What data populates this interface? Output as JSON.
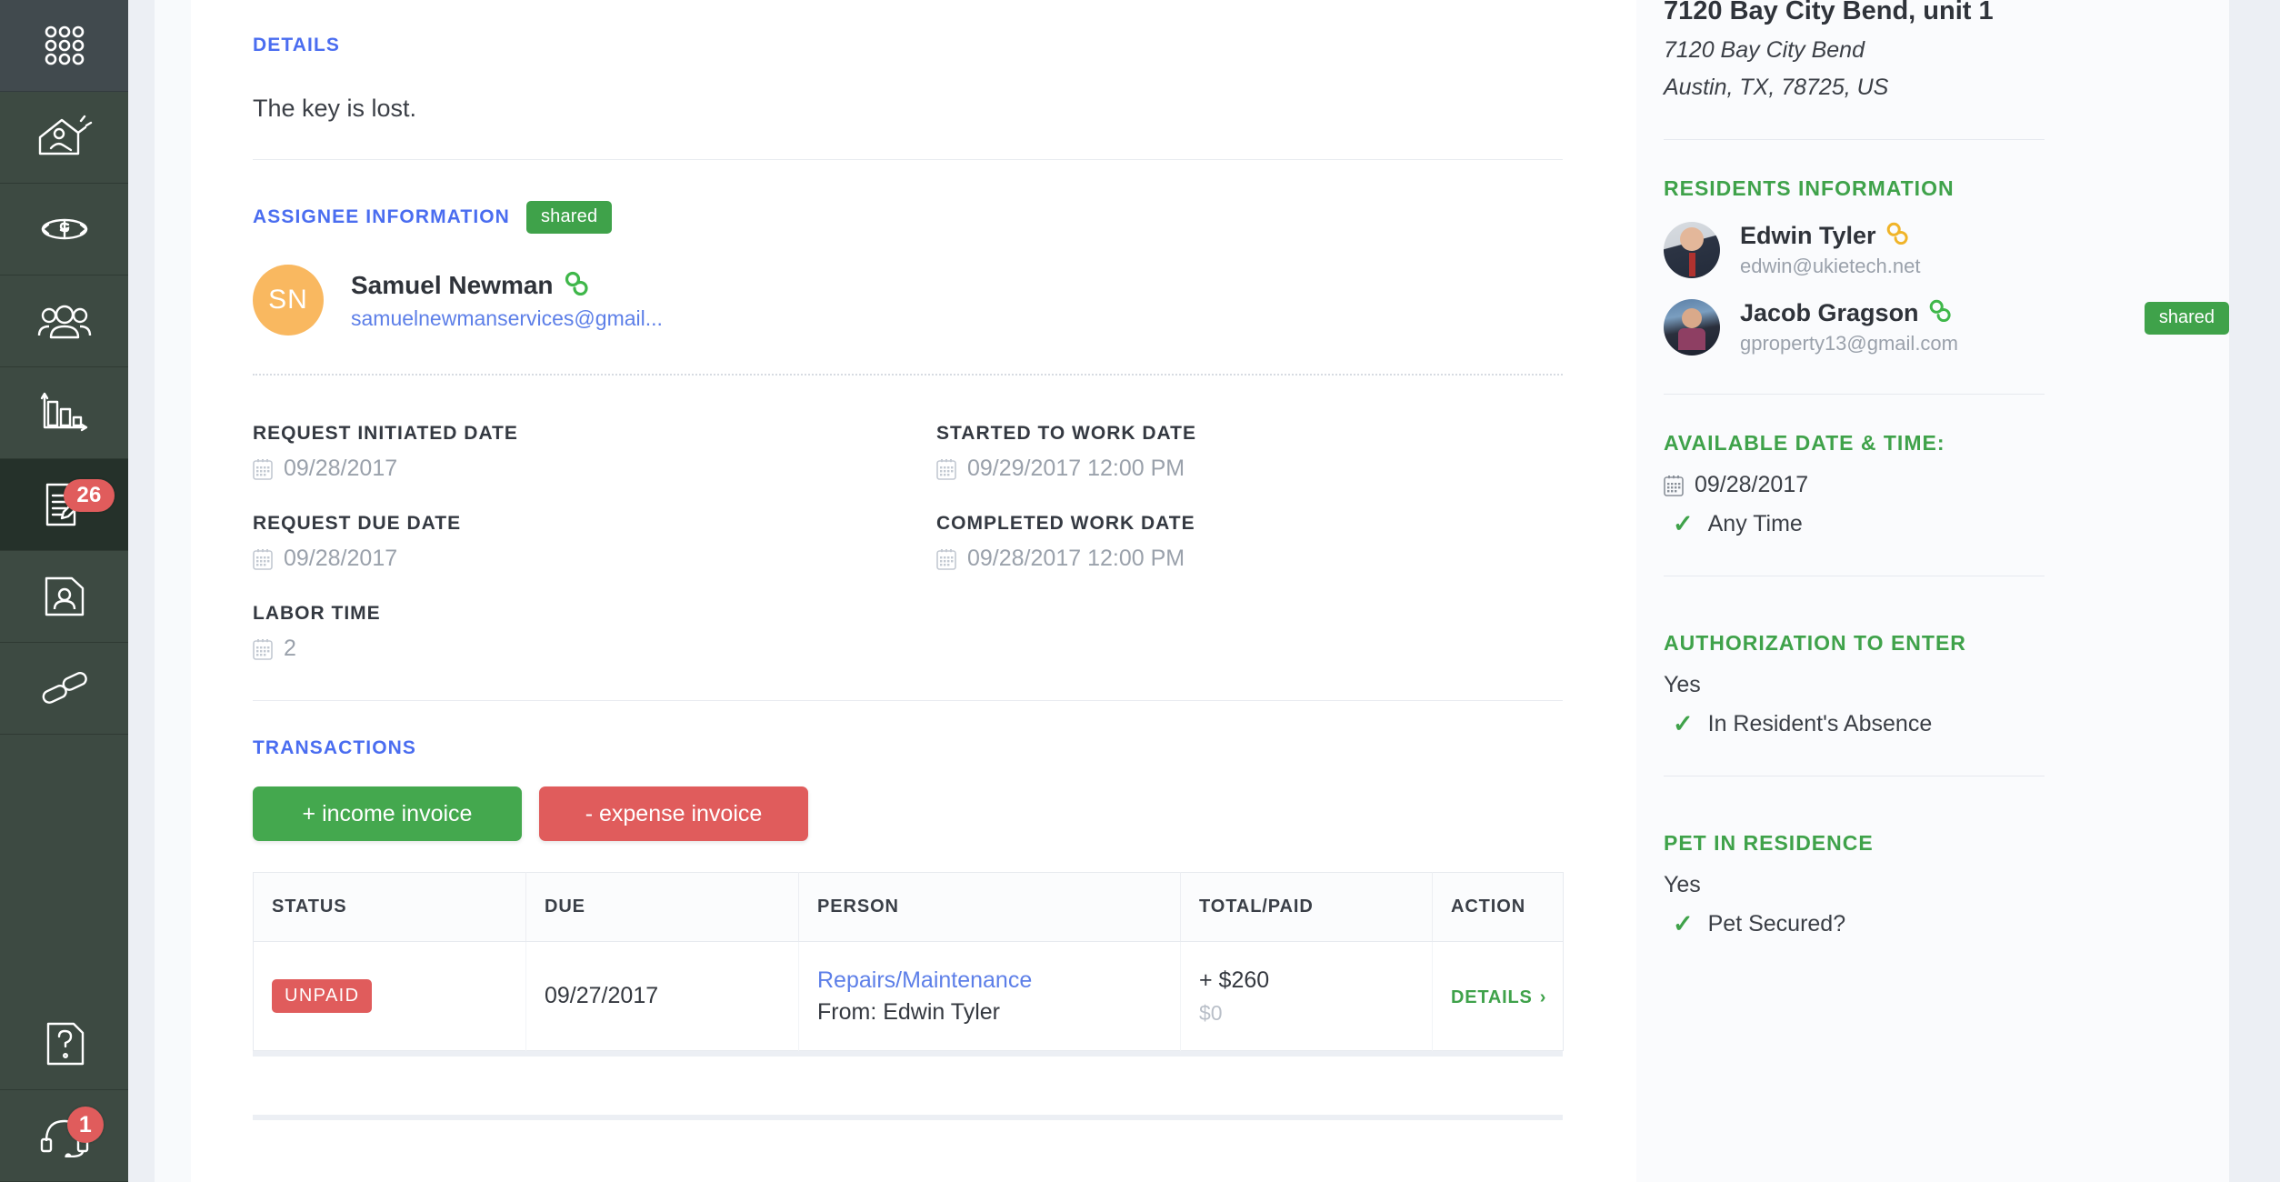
{
  "sidebar": {
    "items": [
      {
        "name": "dashboard",
        "icon": "grid-dots-icon",
        "badge": null,
        "active": false,
        "neutral": true
      },
      {
        "name": "properties",
        "icon": "house-hand-icon",
        "badge": null,
        "active": false,
        "neutral": false
      },
      {
        "name": "finance",
        "icon": "dollar-cycle-icon",
        "badge": null,
        "active": false,
        "neutral": false
      },
      {
        "name": "contacts",
        "icon": "people-icon",
        "badge": null,
        "active": false,
        "neutral": false
      },
      {
        "name": "reports",
        "icon": "bar-chart-icon",
        "badge": null,
        "active": false,
        "neutral": false
      },
      {
        "name": "requests",
        "icon": "document-edit-icon",
        "badge": "26",
        "active": true,
        "neutral": false
      },
      {
        "name": "tenant-file",
        "icon": "id-document-icon",
        "badge": null,
        "active": false,
        "neutral": false
      },
      {
        "name": "maintenance",
        "icon": "wrench-icon",
        "badge": null,
        "active": false,
        "neutral": false
      }
    ],
    "bottom_items": [
      {
        "name": "help",
        "icon": "question-document-icon",
        "badge": null
      },
      {
        "name": "support",
        "icon": "headset-icon",
        "badge": "1"
      }
    ]
  },
  "main": {
    "details": {
      "label": "DETAILS",
      "text": "The key is lost."
    },
    "assignee": {
      "label": "ASSIGNEE INFORMATION",
      "shared_badge": "shared",
      "initials": "SN",
      "name": "Samuel Newman",
      "email": "samuelnewmanservices@gmail..."
    },
    "fields": {
      "request_initiated_date": {
        "label": "REQUEST INITIATED DATE",
        "value": "09/28/2017"
      },
      "started_to_work_date": {
        "label": "STARTED TO WORK DATE",
        "value": "09/29/2017 12:00 PM"
      },
      "request_due_date": {
        "label": "REQUEST DUE DATE",
        "value": "09/28/2017"
      },
      "completed_work_date": {
        "label": "COMPLETED WORK DATE",
        "value": "09/28/2017 12:00 PM"
      },
      "labor_time": {
        "label": "LABOR TIME",
        "value": "2"
      }
    },
    "transactions": {
      "label": "TRANSACTIONS",
      "income_button": "+ income invoice",
      "expense_button": "- expense invoice",
      "columns": [
        "STATUS",
        "DUE",
        "PERSON",
        "TOTAL/PAID",
        "ACTION"
      ],
      "rows": [
        {
          "status": "UNPAID",
          "due": "09/27/2017",
          "person_link": "Repairs/Maintenance",
          "person_from": "From: Edwin Tyler",
          "total": "+ $260",
          "paid": "$0",
          "action": "DETAILS"
        }
      ]
    }
  },
  "right_panel": {
    "property": {
      "title": "7120 Bay City Bend, unit 1",
      "address_line1": "7120 Bay City Bend",
      "address_line2": "Austin, TX, 78725, US"
    },
    "residents": {
      "heading": "RESIDENTS INFORMATION",
      "items": [
        {
          "name": "Edwin Tyler",
          "email": "edwin@ukietech.net",
          "status_color": "#f0b429",
          "shared": null
        },
        {
          "name": "Jacob Gragson",
          "email": "gproperty13@gmail.com",
          "status_color": "#3fa24a",
          "shared": "shared"
        }
      ]
    },
    "available": {
      "heading": "AVAILABLE DATE & TIME:",
      "date": "09/28/2017",
      "time": "Any Time"
    },
    "authorization": {
      "heading": "AUTHORIZATION TO ENTER",
      "value": "Yes",
      "detail": "In Resident's Absence"
    },
    "pet": {
      "heading": "PET IN RESIDENCE",
      "value": "Yes",
      "detail": "Pet Secured?"
    }
  },
  "colors": {
    "accent_blue": "#4a6df0",
    "accent_green": "#3fa24a",
    "accent_red": "#e05c5c",
    "avatar_orange": "#f9b860",
    "rail_bg": "#3d4a42",
    "rail_active": "#25312a"
  }
}
